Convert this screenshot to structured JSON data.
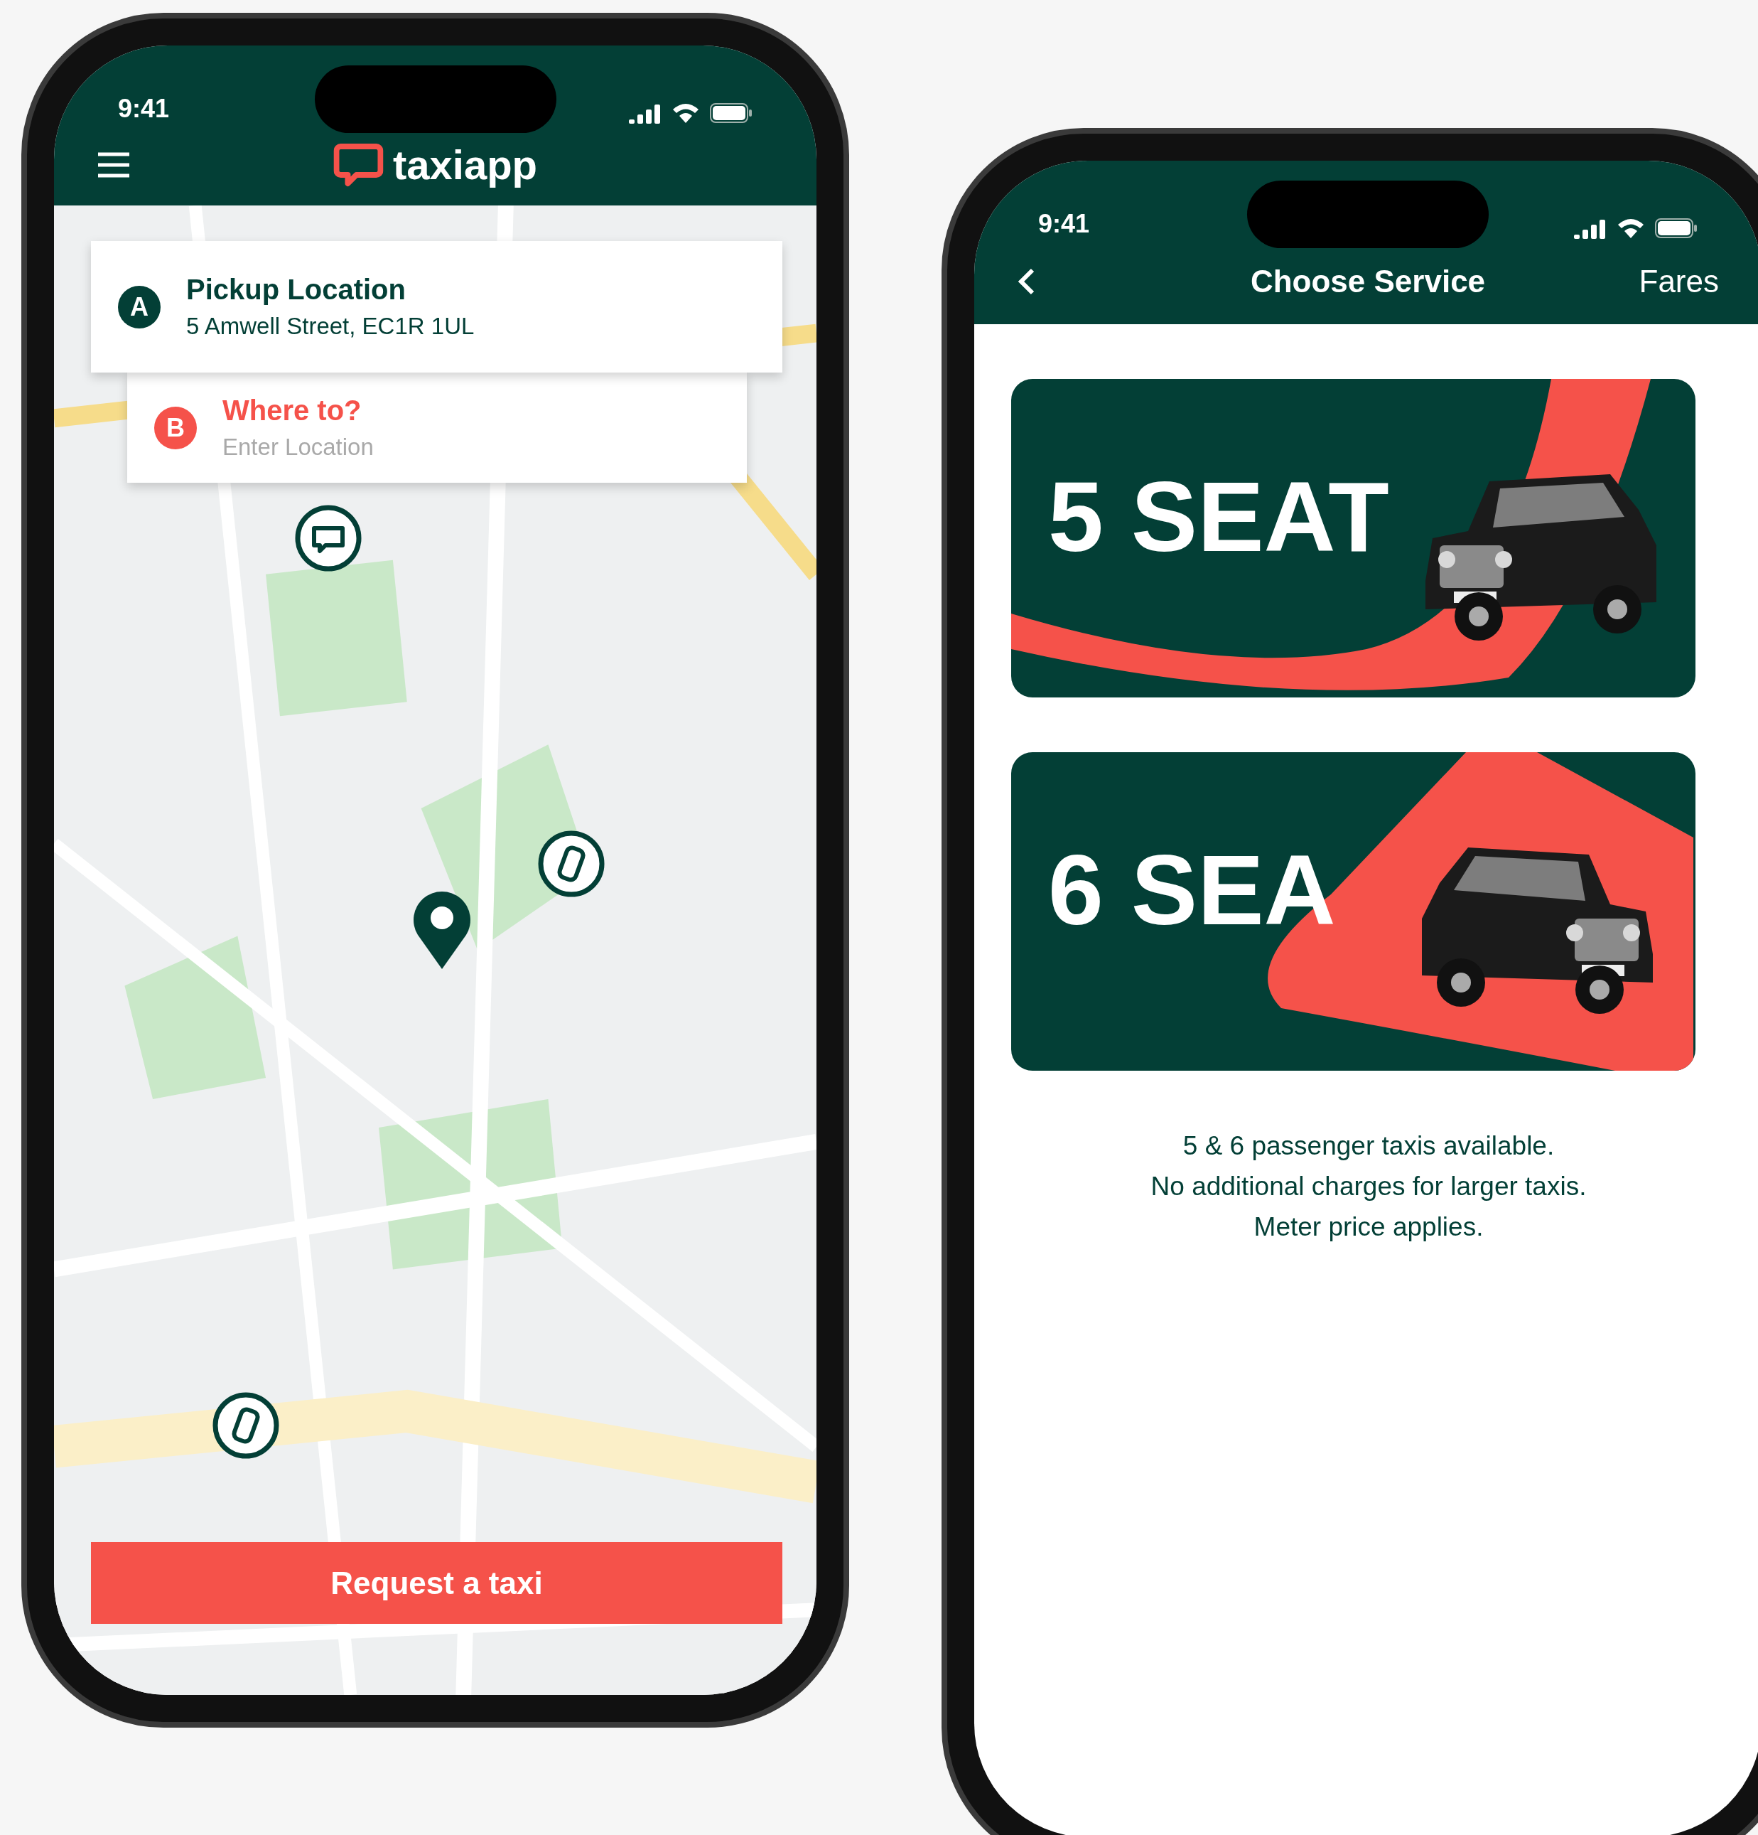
{
  "map_screen": {
    "status_bar": {
      "time": "9:41"
    },
    "header": {
      "logo_text": "taxiapp"
    },
    "pickup": {
      "badge": "A",
      "title": "Pickup Location",
      "address": "5 Amwell Street, EC1R 1UL"
    },
    "destination": {
      "badge": "B",
      "title": "Where to?",
      "placeholder": "Enter Location"
    },
    "markers": [
      {
        "kind": "chat"
      },
      {
        "kind": "car"
      },
      {
        "kind": "pin"
      },
      {
        "kind": "car"
      }
    ],
    "request_button": "Request a taxi"
  },
  "service_screen": {
    "status_bar": {
      "time": "9:41"
    },
    "title": "Choose Service",
    "fares_link": "Fares",
    "services": [
      {
        "label": "5 SEAT"
      },
      {
        "label": "6 SEA"
      }
    ],
    "note_lines": [
      "5 & 6 passenger taxis available.",
      "No additional charges for larger taxis.",
      "Meter price applies."
    ]
  }
}
